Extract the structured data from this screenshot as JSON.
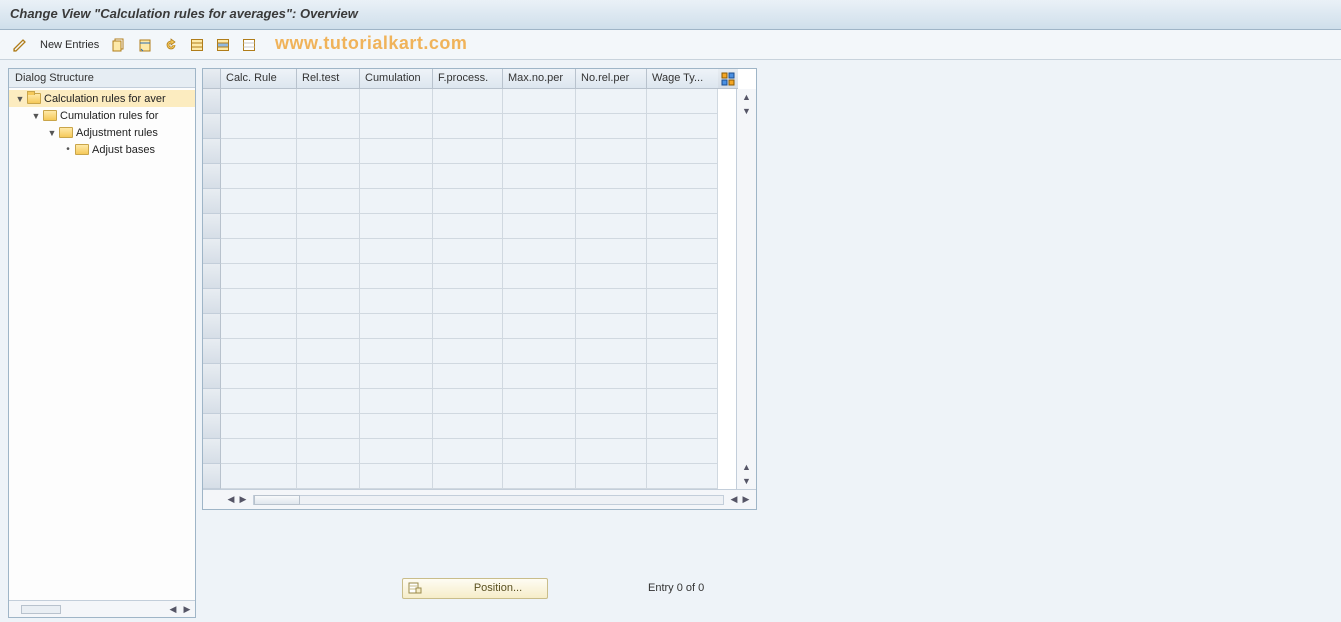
{
  "title": "Change View \"Calculation rules for averages\": Overview",
  "toolbar": {
    "new_entries_label": "New Entries"
  },
  "watermark": "www.tutorialkart.com",
  "sidebar": {
    "header": "Dialog Structure",
    "items": [
      {
        "label": "Calculation rules for aver"
      },
      {
        "label": "Cumulation rules for"
      },
      {
        "label": "Adjustment rules"
      },
      {
        "label": "Adjust bases"
      }
    ]
  },
  "table": {
    "columns": {
      "calc_rule": "Calc. Rule",
      "rel_test": "Rel.test",
      "cumulation": "Cumulation",
      "f_process": "F.process.",
      "max_no_per": "Max.no.per",
      "no_rel_per": "No.rel.per",
      "wage_ty": "Wage Ty..."
    }
  },
  "footer": {
    "position_label": "Position...",
    "entry_text": "Entry 0 of 0"
  }
}
